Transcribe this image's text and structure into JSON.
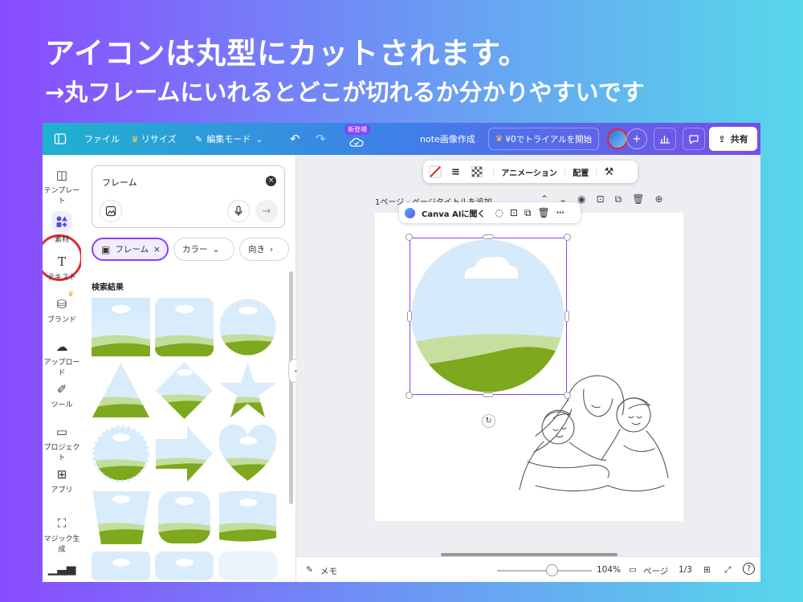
{
  "headline": "アイコンは丸型にカットされます。",
  "subheadline": "→丸フレームにいれるとどこが切れるか分かりやすいです",
  "topbar": {
    "file": "ファイル",
    "resize": "リサイズ",
    "edit_mode": "編集モード",
    "new_badge": "新登場",
    "doc_title": "note画像作成",
    "trial": "¥0でトライアルを開始",
    "share": "共有"
  },
  "rail": {
    "template": "テンプレート",
    "elements": "素材",
    "text": "テキスト",
    "brand": "ブランド",
    "upload": "アップロード",
    "tools": "ツール",
    "projects": "プロジェクト",
    "apps": "アプリ",
    "magic": "マジック生成"
  },
  "panel": {
    "search_value": "フレーム",
    "chip_frame": "フレーム",
    "chip_color": "カラー",
    "chip_direction": "向き",
    "results_title": "検索結果",
    "more": "•••"
  },
  "canvas": {
    "toolbar_animation": "アニメーション",
    "toolbar_arrange": "配置",
    "page_title": "1ページ - ページタイトルを追加",
    "ai_ask": "Canva AIに聞く"
  },
  "statusbar": {
    "memo": "メモ",
    "zoom": "104%",
    "pages_label": "ページ",
    "page_count": "1/3",
    "help": "?"
  }
}
